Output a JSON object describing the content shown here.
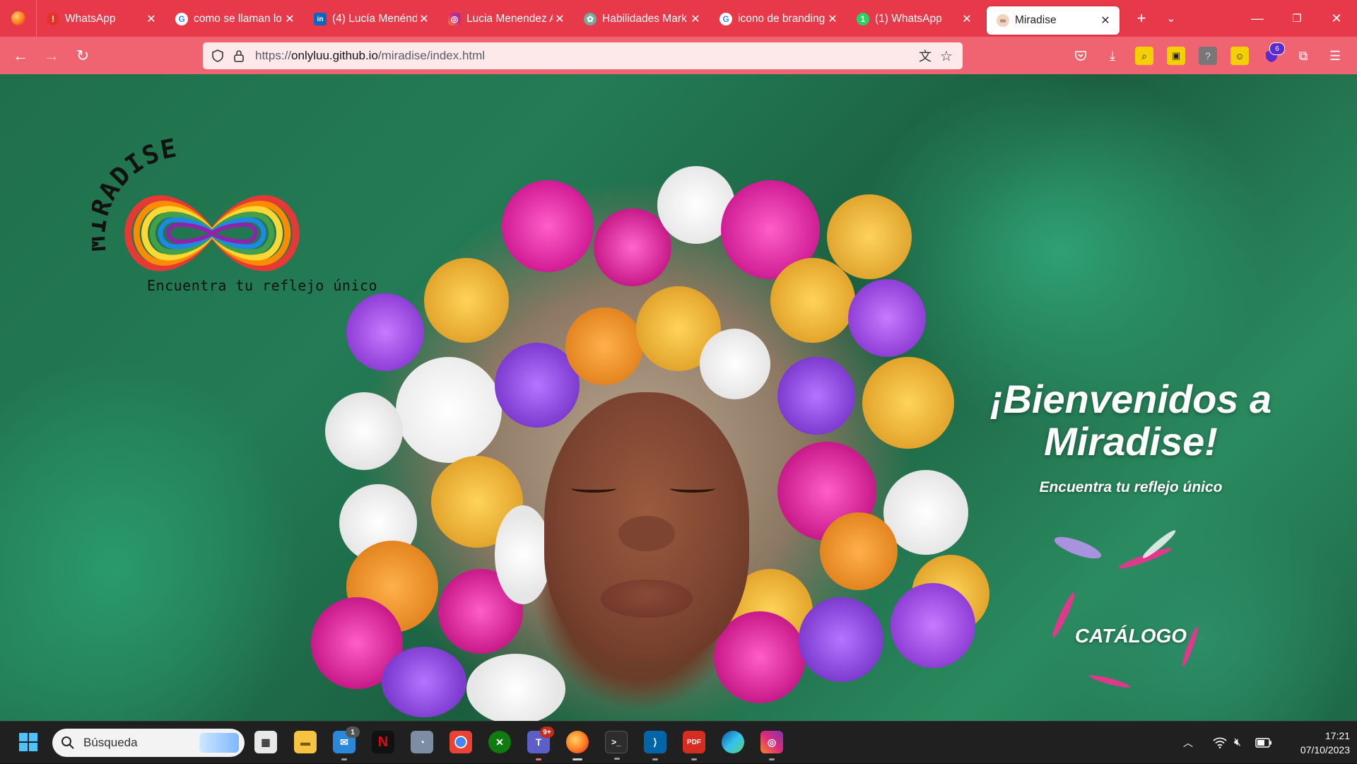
{
  "browser": {
    "tabs": [
      {
        "title": "WhatsApp",
        "favicon": "whatsapp-alert-icon",
        "color": "#e5332a",
        "glyph": "!"
      },
      {
        "title": "como se llaman lo",
        "favicon": "google-icon",
        "color": "#ffffff",
        "glyph": "G"
      },
      {
        "title": "(4) Lucía Menénde",
        "favicon": "linkedin-icon",
        "color": "#0a66c2",
        "glyph": "in"
      },
      {
        "title": "Lucia Menendez A",
        "favicon": "instagram-icon",
        "color": "#d6249f",
        "glyph": "◎"
      },
      {
        "title": "Habilidades Mark",
        "favicon": "chatgpt-icon",
        "color": "#74aa9c",
        "glyph": "✿"
      },
      {
        "title": "icono de branding",
        "favicon": "google-icon",
        "color": "#ffffff",
        "glyph": "G"
      },
      {
        "title": "(1) WhatsApp",
        "favicon": "whatsapp-icon",
        "color": "#25d366",
        "glyph": "1"
      },
      {
        "title": "Miradise",
        "favicon": "miradise-icon",
        "color": "#f2a3a3",
        "glyph": "∞"
      }
    ],
    "url_scheme": "https://",
    "url_host": "onlyluu.github.io",
    "url_path": "/miradise/index.html",
    "extension_badge": "6"
  },
  "page": {
    "logo_word": "MIRADISE",
    "logo_tagline": "Encuentra tu reflejo único",
    "hero_title": "¡Bienvenidos a Miradise!",
    "hero_subtitle": "Encuentra tu reflejo único",
    "catalog_button": "CATÁLOGO"
  },
  "taskbar": {
    "search_placeholder": "Búsqueda",
    "mail_badge": "1",
    "teams_badge": "9+",
    "time": "17:21",
    "date": "07/10/2023"
  },
  "colors": {
    "tab_strip": "#e8394a",
    "nav_bar": "#f06472",
    "url_bg": "#fde9ea",
    "taskbar": "#202020"
  }
}
